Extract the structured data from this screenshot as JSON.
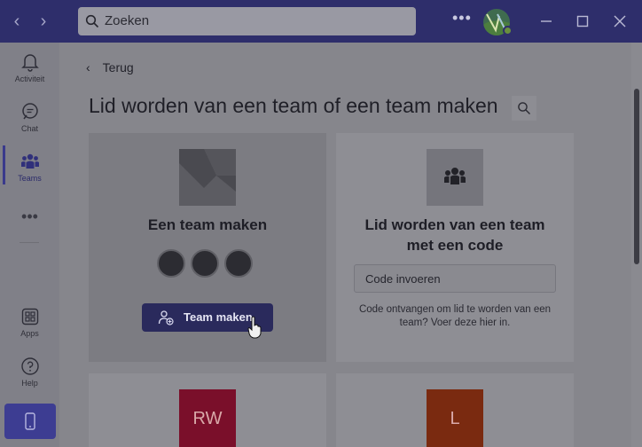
{
  "titlebar": {
    "search_placeholder": "Zoeken",
    "more_label": "•••",
    "avatar_initials": "AV"
  },
  "rail": {
    "items": [
      {
        "label": "Activiteit",
        "icon": "bell-icon"
      },
      {
        "label": "Chat",
        "icon": "chat-icon"
      },
      {
        "label": "Teams",
        "icon": "teams-icon"
      },
      {
        "label": "Apps",
        "icon": "apps-icon"
      },
      {
        "label": "Help",
        "icon": "help-icon"
      }
    ],
    "more_label": "•••"
  },
  "main": {
    "back_label": "Terug",
    "page_title": "Lid worden van een team of een team maken",
    "create_card": {
      "title": "Een team maken",
      "button_label": "Team maken"
    },
    "join_card": {
      "title_line1": "Lid worden van een team",
      "title_line2": "met een code",
      "input_placeholder": "Code invoeren",
      "help_text": "Code ontvangen om lid te worden van een team? Voer deze hier in."
    },
    "team_tiles": [
      {
        "initials": "RW",
        "color": "#7a0f2a"
      },
      {
        "initials": "L",
        "color": "#7a2a10"
      }
    ]
  },
  "colors": {
    "titlebar": "#2e2e6b",
    "accent": "#3d3d92",
    "overlay_bg": "#86868c"
  }
}
